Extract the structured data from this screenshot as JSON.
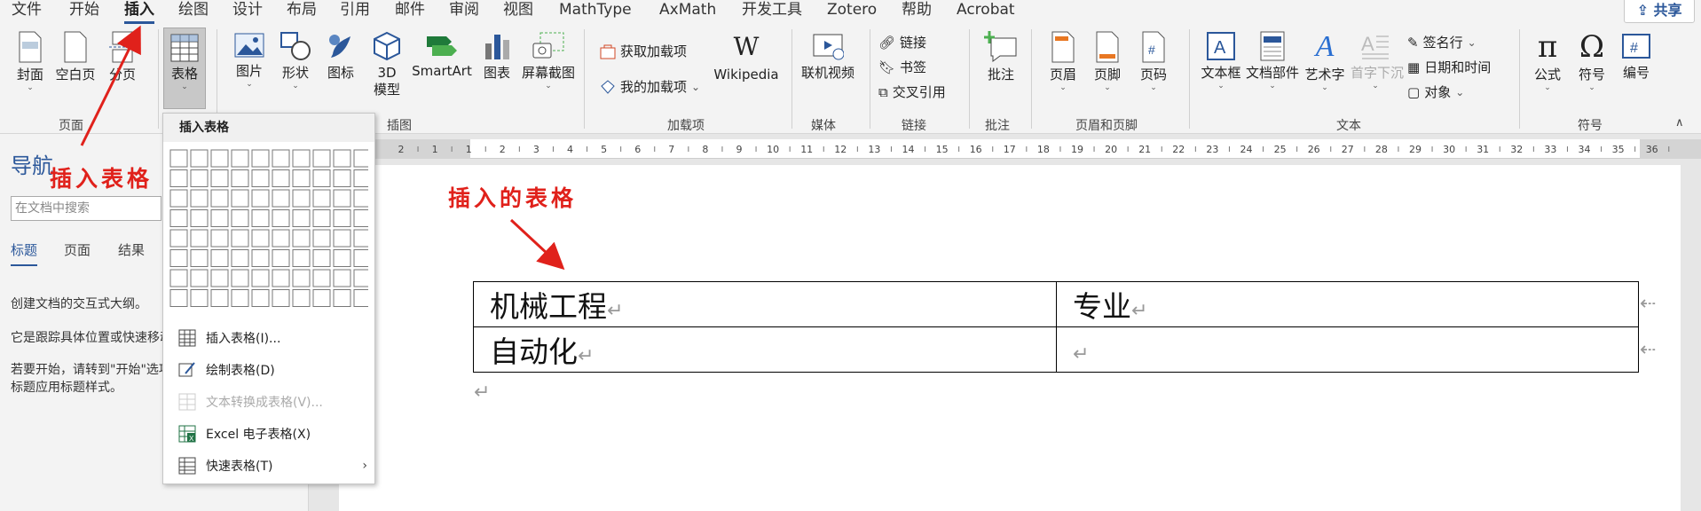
{
  "tabs": [
    "文件",
    "开始",
    "插入",
    "绘图",
    "设计",
    "布局",
    "引用",
    "邮件",
    "审阅",
    "视图",
    "MathType",
    "AxMath",
    "开发工具",
    "Zotero",
    "帮助",
    "Acrobat"
  ],
  "share_label": "共享",
  "ribbon": {
    "pages": {
      "cover": "封面",
      "blank": "空白页",
      "page_break": "分页",
      "group": "页面"
    },
    "table": {
      "label": "表格",
      "group": "表格"
    },
    "illustrations": {
      "picture": "图片",
      "shapes": "形状",
      "icons": "图标",
      "model3d_1": "3D",
      "model3d_2": "模型",
      "smartart": "SmartArt",
      "chart": "图表",
      "screenshot": "屏幕截图",
      "group": "插图"
    },
    "addins": {
      "get": "获取加载项",
      "mine": "我的加载项",
      "wikipedia": "Wikipedia",
      "group": "加载项"
    },
    "media": {
      "online_video": "联机视频",
      "group": "媒体"
    },
    "links": {
      "link": "链接",
      "bookmark": "书签",
      "cross_ref": "交叉引用",
      "group": "链接"
    },
    "comments": {
      "comment": "批注",
      "group": "批注"
    },
    "header_footer": {
      "header": "页眉",
      "footer": "页脚",
      "page_number": "页码",
      "group": "页眉和页脚"
    },
    "text": {
      "textbox": "文本框",
      "quickparts": "文档部件",
      "wordart": "艺术字",
      "dropcap": "首字下沉",
      "signature": "签名行",
      "datetime": "日期和时间",
      "object": "对象",
      "group": "文本"
    },
    "symbols": {
      "equation": "公式",
      "symbol": "符号",
      "number": "编号",
      "group": "符号"
    }
  },
  "nav": {
    "title": "导航",
    "search_placeholder": "在文档中搜索",
    "tabs": [
      "标题",
      "页面",
      "结果"
    ],
    "text1": "创建文档的交互式大纲。",
    "text2": "它是跟踪具体位置或快速移动",
    "text3a": "若要开始，请转到\"开始\"选项",
    "text3b": "标题应用标题样式。"
  },
  "menu": {
    "header": "插入表格",
    "items": {
      "insert_table": "插入表格(I)...",
      "draw_table": "绘制表格(D)",
      "convert": "文本转换成表格(V)...",
      "excel": "Excel 电子表格(X)",
      "quick": "快速表格(T)"
    }
  },
  "table": {
    "r1c1": "机械工程",
    "r1c2": "专业",
    "r2c1": "自动化",
    "r2c2": ""
  },
  "annotations": {
    "nav_arrow_text": "插入表格",
    "doc_arrow_text": "插入的表格"
  },
  "ruler_numbers": [
    "2",
    "1",
    "1",
    "2",
    "3",
    "4",
    "5",
    "6",
    "7",
    "8",
    "9",
    "10",
    "11",
    "12",
    "13",
    "14",
    "15",
    "16",
    "17",
    "18",
    "19",
    "20",
    "21",
    "22",
    "23",
    "24",
    "25",
    "26",
    "27",
    "28",
    "29",
    "30",
    "31",
    "32",
    "33",
    "34",
    "35",
    "36"
  ],
  "colors": {
    "accent": "#2b579a",
    "annotation": "#e0211b"
  }
}
